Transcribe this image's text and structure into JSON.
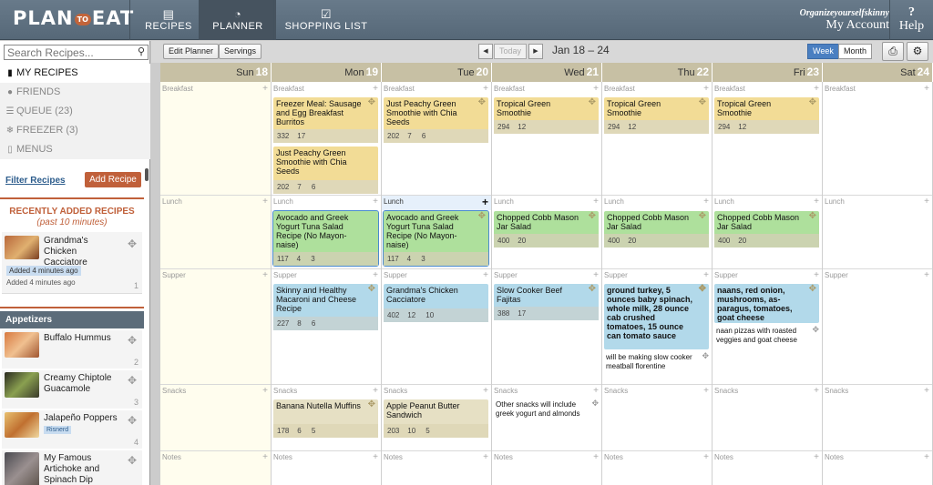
{
  "brand": {
    "logo_left": "PLAN",
    "logo_mid": "TO",
    "logo_right": "EAT"
  },
  "nav": [
    {
      "label": "RECIPES",
      "icon": "newspaper-icon"
    },
    {
      "label": "PLANNER",
      "icon": "clock-icon"
    },
    {
      "label": "SHOPPING LIST",
      "icon": "checklist-icon"
    }
  ],
  "account": {
    "username": "Organizeyourselfskinny",
    "label": "My Account"
  },
  "help": {
    "label": "Help",
    "mark": "?"
  },
  "sidebar": {
    "search_placeholder": "Search Recipes...",
    "menu": [
      {
        "label": "MY RECIPES",
        "icon": "book-icon"
      },
      {
        "label": "FRIENDS",
        "icon": "person-icon"
      },
      {
        "label": "QUEUE (23)",
        "icon": "list-icon"
      },
      {
        "label": "FREEZER (3)",
        "icon": "snowflake-icon"
      },
      {
        "label": "MENUS",
        "icon": "menus-icon"
      }
    ],
    "filter_link": "Filter Recipes",
    "add_recipe": "Add Recipe",
    "recent_title": "RECENTLY ADDED RECIPES",
    "recent_sub": "(past 10 minutes)",
    "recent": [
      {
        "name": "Grandma's Chicken Cacciatore",
        "tag": "Added 4 minutes ago",
        "added": "Added 4 minutes ago",
        "count": "1"
      }
    ],
    "section_title": "Appetizers",
    "appetizers": [
      {
        "name": "Buffalo Hummus",
        "count": "2",
        "tag": ""
      },
      {
        "name": "Creamy Chiptole Guacamole",
        "count": "3",
        "tag": ""
      },
      {
        "name": "Jalapeño Poppers",
        "count": "4",
        "tag": "Risnerd"
      },
      {
        "name": "My Famous Artichoke and Spinach Dip",
        "count": "",
        "tag": ""
      }
    ]
  },
  "toolbar": {
    "edit_planner": "Edit Planner",
    "servings": "Servings",
    "today": "Today",
    "range": "Jan 18 – 24",
    "week": "Week",
    "month": "Month",
    "prev": "◀",
    "next": "▶"
  },
  "days": [
    {
      "name": "Sun",
      "num": "18"
    },
    {
      "name": "Mon",
      "num": "19"
    },
    {
      "name": "Tue",
      "num": "20"
    },
    {
      "name": "Wed",
      "num": "21"
    },
    {
      "name": "Thu",
      "num": "22"
    },
    {
      "name": "Fri",
      "num": "23"
    },
    {
      "name": "Sat",
      "num": "24"
    }
  ],
  "meals": [
    "Breakfast",
    "Lunch",
    "Supper",
    "Snacks",
    "Notes"
  ],
  "cards": {
    "mon_b1": {
      "title": "Freezer Meal: Sausage and Egg Breakfast Burritos",
      "s1": "332",
      "s2": "17",
      "s3": ""
    },
    "mon_b2": {
      "title": "Just Peachy Green Smoothie with Chia Seeds",
      "s1": "202",
      "s2": "7",
      "s3": "6"
    },
    "tue_b1": {
      "title": "Just Peachy Green Smoothie with Chia Seeds",
      "s1": "202",
      "s2": "7",
      "s3": "6"
    },
    "wed_b1": {
      "title": "Tropical Green Smoothie",
      "s1": "294",
      "s2": "12",
      "s3": ""
    },
    "thu_b1": {
      "title": "Tropical Green Smoothie",
      "s1": "294",
      "s2": "12",
      "s3": ""
    },
    "fri_b1": {
      "title": "Tropical Green Smoothie",
      "s1": "294",
      "s2": "12",
      "s3": ""
    },
    "mon_l1": {
      "title": "Avocado and Greek Yogurt Tuna Salad Recipe (No Mayon­naise)",
      "s1": "117",
      "s2": "4",
      "s3": "3"
    },
    "tue_l1": {
      "title": "Avocado and Greek Yogurt Tuna Salad Recipe (No Mayon­naise)",
      "s1": "117",
      "s2": "4",
      "s3": "3"
    },
    "wed_l1": {
      "title": "Chopped Cobb Ma­son Jar Salad",
      "s1": "400",
      "s2": "20",
      "s3": ""
    },
    "thu_l1": {
      "title": "Chopped Cobb Ma­son Jar Salad",
      "s1": "400",
      "s2": "20",
      "s3": ""
    },
    "fri_l1": {
      "title": "Chopped Cobb Ma­son Jar Salad",
      "s1": "400",
      "s2": "20",
      "s3": ""
    },
    "mon_s1": {
      "title": "Skinny and Healthy Macaroni and Cheese Recipe",
      "s1": "227",
      "s2": "8",
      "s3": "6"
    },
    "tue_s1": {
      "title": "Grandma's Chicken Cacciatore",
      "s1": "402",
      "s2": "12",
      "s3": "10"
    },
    "wed_s1": {
      "title": "Slow Cooker Beef Fajitas",
      "s1": "388",
      "s2": "17",
      "s3": ""
    },
    "thu_s1": {
      "title": "ground turkey, 5 ounces baby spinach, whole milk, 28 ounce cab crushed tomatoes, 15 ounce can tomato sauce",
      "s1": "",
      "s2": "",
      "s3": ""
    },
    "fri_s1": {
      "title": "naans, red onion, mushrooms, as­paragus, tomatoes, goat cheese",
      "s1": "",
      "s2": "",
      "s3": ""
    },
    "mon_n1": {
      "title": "Banana Nutella Muffins",
      "s1": "178",
      "s2": "6",
      "s3": "5"
    },
    "tue_n1": {
      "title": "Apple Peanut Butter Sandwich",
      "s1": "203",
      "s2": "10",
      "s3": "5"
    }
  },
  "notes": {
    "thu_s_note": "will be making slow cooker meatball flo­rentine",
    "fri_s_note": "naan pizzas with roasted veggies and goat cheese",
    "wed_snack_note": "Other snacks will include greek yogurt and almonds"
  }
}
